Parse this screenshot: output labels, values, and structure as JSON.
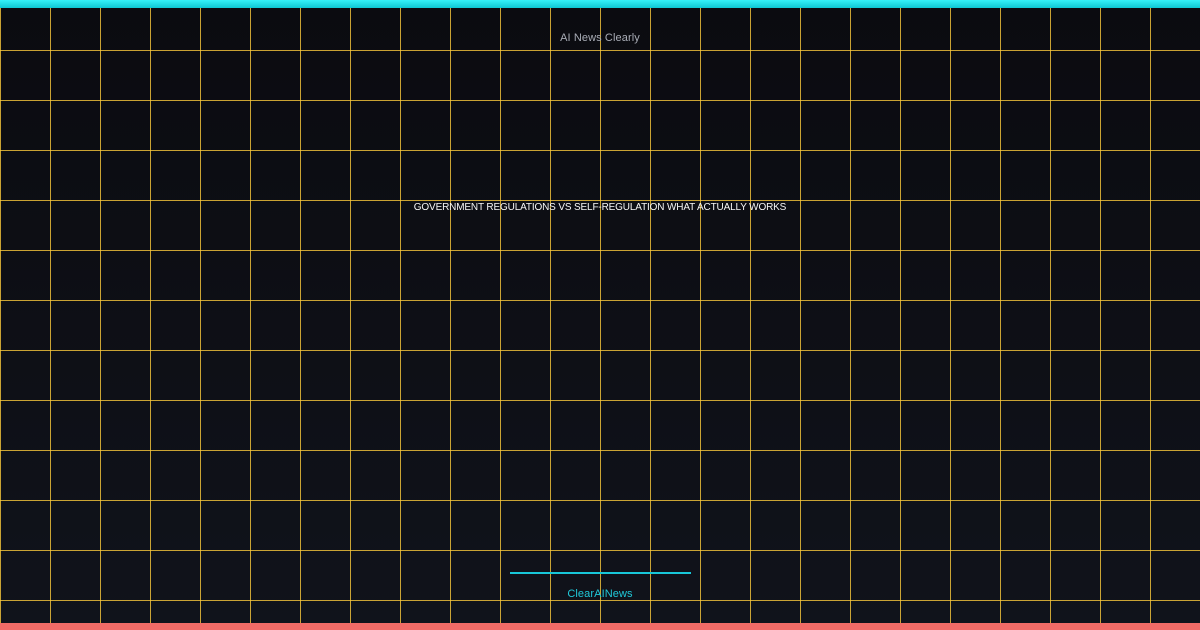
{
  "page": {
    "site_name": "AI News Clearly",
    "headline": "GOVERNMENT REGULATIONS VS SELF-REGULATION WHAT ACTUALLY WORKS",
    "brand": "ClearAINews"
  },
  "colors": {
    "background": "#0d0f14",
    "grid": "#ffcd3c",
    "top_bar": "#1fd5de",
    "bottom_bar": "#f06b67",
    "accent": "#18c7d8",
    "headline": "#f6f6f6",
    "muted_text": "#a9adb6"
  }
}
